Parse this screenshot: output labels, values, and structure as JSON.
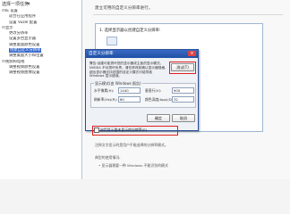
{
  "left_panel": {
    "title": "选择一项任务:",
    "tree": [
      {
        "label": "IE 设置",
        "expander": "⊟"
      },
      {
        "label": "适合在应用程序",
        "expander": ""
      },
      {
        "label": "设置 Vuzel 配置",
        "expander": ""
      },
      {
        "label": "显示",
        "expander": "⊟"
      },
      {
        "label": "更改分辨率",
        "expander": ""
      },
      {
        "label": "设置多台显示器",
        "expander": ""
      },
      {
        "label": "调整桌面颜色设置",
        "expander": ""
      },
      {
        "label": "创建自定义分辨率",
        "expander": "",
        "selected": true
      },
      {
        "label": "调整桌面大小和位置",
        "expander": ""
      },
      {
        "label": "视频和电视",
        "expander": "⊟"
      },
      {
        "label": "调整视频颜色设置",
        "expander": ""
      },
      {
        "label": "调整视频图像设置",
        "expander": ""
      },
      {
        "label": "",
        "expander": ""
      }
    ]
  },
  "main": {
    "heading": "建立可用的自定义分辨率进行。",
    "step_label": "1. 选择显示器以创建自定义分辨率:"
  },
  "dialog": {
    "title": "自定义分辨率",
    "description": "警告:创建可能损坏您的显示器或主板的显示模式。NVIDIA 不对损坏负责。请在修改前确认显示器规格,超出显示器支持范围的自定义模式可能导致 Windows 显示错误。",
    "test_button": "测试(T)",
    "group_title": "显示模式(由 Windows 报告)",
    "fields": [
      {
        "label": "水平像素(H):",
        "value": "1440"
      },
      {
        "label": "刷新率(Hz)(R):",
        "value": "60"
      },
      {
        "label": "垂直行(V):",
        "value": "900"
      },
      {
        "label": "颜色深度(bpp)(D):",
        "value": "32"
      }
    ],
    "ok_button": "确定",
    "cancel_button": "取消",
    "checkbox_label": "启用显示器未显示的分辨率(E)"
  },
  "bottom": {
    "line1": "注释文字显示的是用户不能选择的分辨率模式。",
    "line2": "典型的使用情况:",
    "line3": "• 显示器需要一种 Windows 不能识别的模式"
  },
  "colors": {
    "accent": "#3366cc",
    "title_bar": "#1f4fa4",
    "highlight_frame": "#e02020"
  }
}
